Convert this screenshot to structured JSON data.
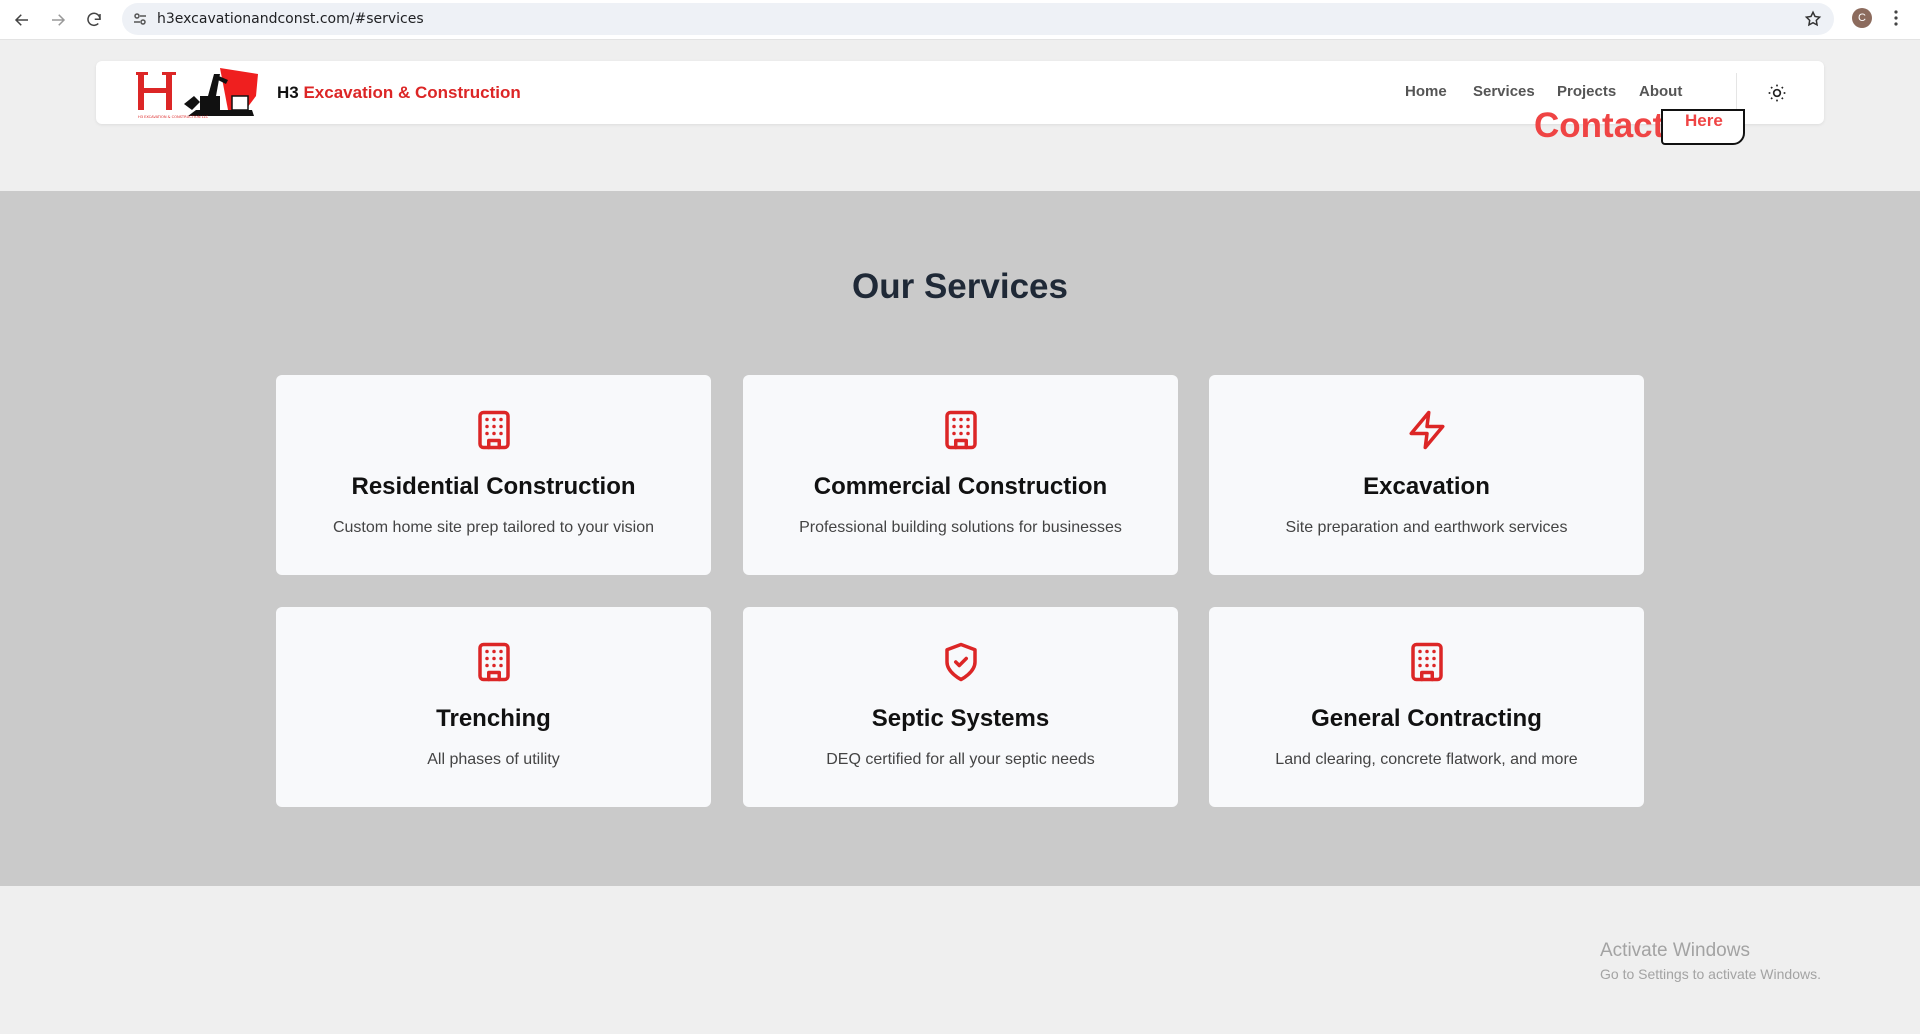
{
  "browser": {
    "url": "h3excavationandconst.com/#services",
    "profile_initial": "C"
  },
  "header": {
    "brand_prefix": "H3",
    "brand_accent": "Excavation & Construction",
    "nav": [
      "Home",
      "Services",
      "Projects",
      "About"
    ],
    "contact": "Contact",
    "here": "Here",
    "logo_text": "H3 EXCAVATION & CONSTRUCTION LLC"
  },
  "services": {
    "title": "Our Services",
    "items": [
      {
        "title": "Residential Construction",
        "desc": "Custom home site prep tailored to your vision",
        "icon": "building-icon"
      },
      {
        "title": "Commercial Construction",
        "desc": "Professional building solutions for businesses",
        "icon": "building-icon"
      },
      {
        "title": "Excavation",
        "desc": "Site preparation and earthwork services",
        "icon": "lightning-icon"
      },
      {
        "title": "Trenching",
        "desc": "All phases of utility",
        "icon": "building-icon"
      },
      {
        "title": "Septic Systems",
        "desc": "DEQ certified for all your septic needs",
        "icon": "shield-check-icon"
      },
      {
        "title": "General Contracting",
        "desc": "Land clearing, concrete flatwork, and more",
        "icon": "building-icon"
      }
    ]
  },
  "watermark": {
    "line1": "Activate Windows",
    "line2": "Go to Settings to activate Windows."
  },
  "colors": {
    "accent": "#dc2626",
    "section_bg": "#cacaca",
    "page_bg": "#efefef",
    "card_bg": "#f8f9fb"
  }
}
